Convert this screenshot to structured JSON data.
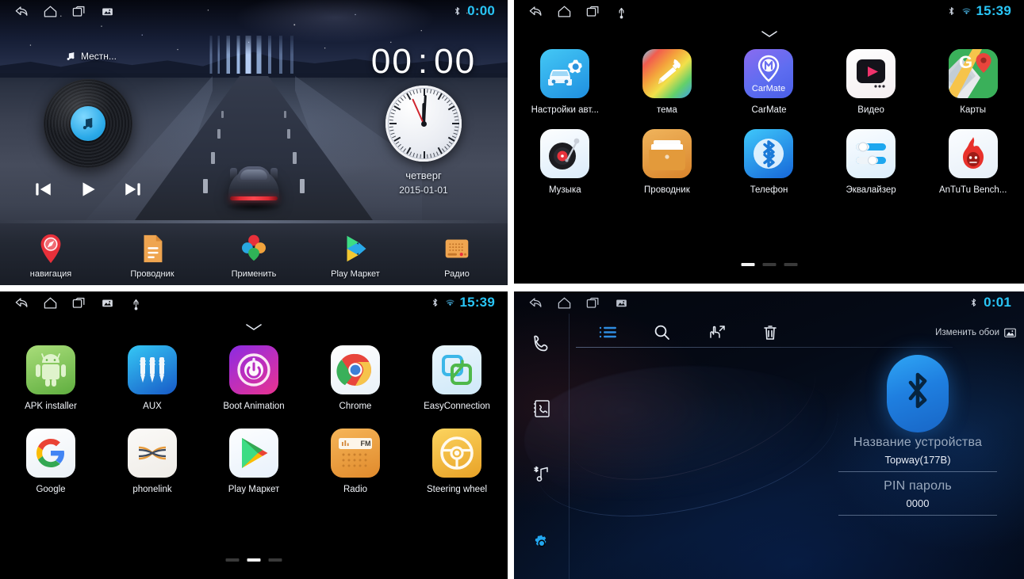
{
  "panes": {
    "home": {
      "statusbar": {
        "left_icons": [
          "back-icon",
          "home-icon",
          "recents-icon",
          "screenshot-icon"
        ],
        "right_icons": [
          "bluetooth-icon"
        ],
        "time": "0:00",
        "time_color": "#29c5f6"
      },
      "media": {
        "source_label": "Местн...",
        "source_icon": "music-note-icon",
        "disc_icon": "music-note-icon",
        "prev_label": "prev-track-icon",
        "play_label": "play-icon",
        "next_label": "next-track-icon"
      },
      "clock": {
        "digital_hours": "00",
        "digital_separator": ":",
        "digital_minutes": "00",
        "weekday": "четверг",
        "date": "2015-01-01"
      },
      "dock": [
        {
          "label": "навигация",
          "icon": "navigation-pin-icon"
        },
        {
          "label": "Проводник",
          "icon": "file-manager-icon"
        },
        {
          "label": "Применить",
          "icon": "apply-petals-icon"
        },
        {
          "label": "Play Маркет",
          "icon": "play-store-icon"
        },
        {
          "label": "Радио",
          "icon": "radio-icon"
        }
      ]
    },
    "apps_page1": {
      "statusbar": {
        "left_icons": [
          "back-icon",
          "home-icon",
          "recents-icon",
          "usb-icon"
        ],
        "right_icons": [
          "bluetooth-icon",
          "wifi-icon"
        ],
        "time": "15:39",
        "time_color": "#29c5f6"
      },
      "handle_icon": "chevron-down-icon",
      "apps": [
        {
          "label": "Настройки авт...",
          "icon": "car-settings-icon"
        },
        {
          "label": "тема",
          "icon": "theme-brush-icon"
        },
        {
          "label": "CarMate",
          "icon": "carmate-icon"
        },
        {
          "label": "Видео",
          "icon": "video-player-icon"
        },
        {
          "label": "Карты",
          "icon": "google-maps-icon"
        },
        {
          "label": "Музыка",
          "icon": "music-turntable-icon"
        },
        {
          "label": "Проводник",
          "icon": "file-explorer-icon"
        },
        {
          "label": "Телефон",
          "icon": "bluetooth-phone-icon"
        },
        {
          "label": "Эквалайзер",
          "icon": "equalizer-icon"
        },
        {
          "label": "AnTuTu Bench...",
          "icon": "antutu-icon"
        }
      ],
      "pages": 3,
      "active_page": 1
    },
    "apps_page2": {
      "statusbar": {
        "left_icons": [
          "back-icon",
          "home-icon",
          "recents-icon",
          "screenshot-icon",
          "usb-icon"
        ],
        "right_icons": [
          "bluetooth-icon",
          "wifi-icon"
        ],
        "time": "15:39",
        "time_color": "#29c5f6"
      },
      "handle_icon": "chevron-down-icon",
      "apps": [
        {
          "label": "APK installer",
          "icon": "android-icon"
        },
        {
          "label": "AUX",
          "icon": "aux-jack-icon"
        },
        {
          "label": "Boot Animation",
          "icon": "power-boot-icon"
        },
        {
          "label": "Chrome",
          "icon": "chrome-icon"
        },
        {
          "label": "EasyConnection",
          "icon": "easyconnection-icon"
        },
        {
          "label": "Google",
          "icon": "google-g-icon"
        },
        {
          "label": "phonelink",
          "icon": "phonelink-icon"
        },
        {
          "label": "Play Маркет",
          "icon": "play-store-icon"
        },
        {
          "label": "Radio",
          "icon": "fm-radio-icon"
        },
        {
          "label": "Steering wheel",
          "icon": "steering-wheel-icon"
        }
      ],
      "pages": 3,
      "active_page": 2
    },
    "bluetooth": {
      "statusbar": {
        "left_icons": [
          "back-icon",
          "home-icon",
          "recents-icon",
          "screenshot-icon"
        ],
        "right_icons": [
          "bluetooth-icon"
        ],
        "time": "0:01",
        "time_color": "#29c5f6"
      },
      "sidebar": [
        {
          "icon": "dialpad-phone-icon",
          "active": false
        },
        {
          "icon": "contacts-book-icon",
          "active": false
        },
        {
          "icon": "bluetooth-music-icon",
          "active": false
        },
        {
          "icon": "gear-icon",
          "active": true
        }
      ],
      "toolbar": [
        {
          "icon": "list-icon",
          "active": true
        },
        {
          "icon": "search-icon",
          "active": false
        },
        {
          "icon": "pair-hand-icon",
          "active": false
        },
        {
          "icon": "trash-icon",
          "active": false
        }
      ],
      "wallpaper_button": {
        "label": "Изменить обои",
        "icon": "image-icon"
      },
      "fields": {
        "device_name_label": "Название устройства",
        "device_name_value": "Topway(177B)",
        "pin_label": "PIN пароль",
        "pin_value": "0000"
      },
      "logo_icon": "bluetooth-icon"
    }
  }
}
